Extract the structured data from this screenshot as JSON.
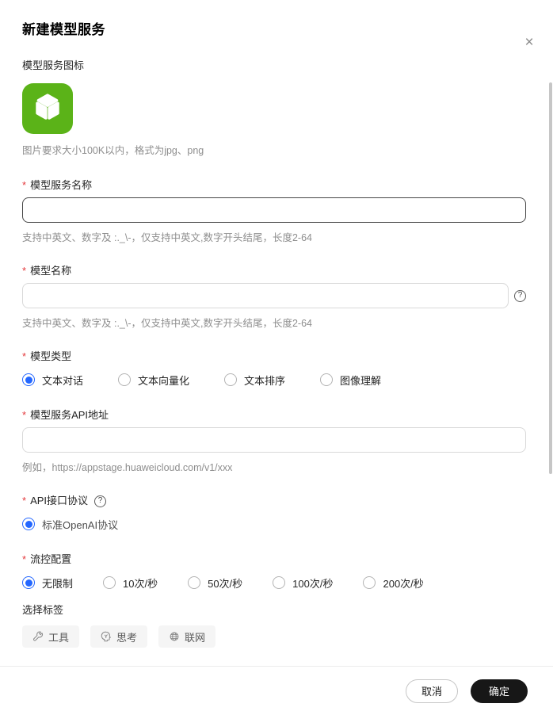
{
  "dialog": {
    "title": "新建模型服务",
    "close_glyph": "×"
  },
  "icon_section": {
    "label": "模型服务图标",
    "hint": "图片要求大小100K以内，格式为jpg、png"
  },
  "service_name": {
    "label": "模型服务名称",
    "value": "",
    "placeholder": "",
    "hint": "支持中英文、数字及 :._\\-，仅支持中英文,数字开头结尾，长度2-64"
  },
  "model_name": {
    "label": "模型名称",
    "value": "",
    "placeholder": "",
    "help_glyph": "?",
    "hint": "支持中英文、数字及 :._\\-，仅支持中英文,数字开头结尾，长度2-64"
  },
  "model_type": {
    "label": "模型类型",
    "options": [
      {
        "label": "文本对话",
        "selected": true
      },
      {
        "label": "文本向量化",
        "selected": false
      },
      {
        "label": "文本排序",
        "selected": false
      },
      {
        "label": "图像理解",
        "selected": false
      }
    ]
  },
  "api_address": {
    "label": "模型服务API地址",
    "value": "",
    "placeholder": "",
    "hint": "例如，https://appstage.huaweicloud.com/v1/xxx"
  },
  "api_protocol": {
    "label": "API接口协议",
    "help_glyph": "?",
    "options": [
      {
        "label": "标准OpenAI协议",
        "selected": true
      }
    ]
  },
  "flow_control": {
    "label": "流控配置",
    "options": [
      {
        "label": "无限制",
        "selected": true
      },
      {
        "label": "10次/秒",
        "selected": false
      },
      {
        "label": "50次/秒",
        "selected": false
      },
      {
        "label": "100次/秒",
        "selected": false
      },
      {
        "label": "200次/秒",
        "selected": false
      }
    ]
  },
  "tags": {
    "label": "选择标签",
    "chips": [
      {
        "icon": "wrench-icon",
        "label": "工具"
      },
      {
        "icon": "thinking-icon",
        "label": "思考"
      },
      {
        "icon": "globe-icon",
        "label": "联网"
      }
    ]
  },
  "footer": {
    "cancel_label": "取消",
    "confirm_label": "确定"
  },
  "required_mark": "*",
  "colors": {
    "radio_selected": "#2467FF",
    "icon_green": "#5BB318",
    "required_red": "#E4393C",
    "confirm_button_bg": "#171717"
  }
}
